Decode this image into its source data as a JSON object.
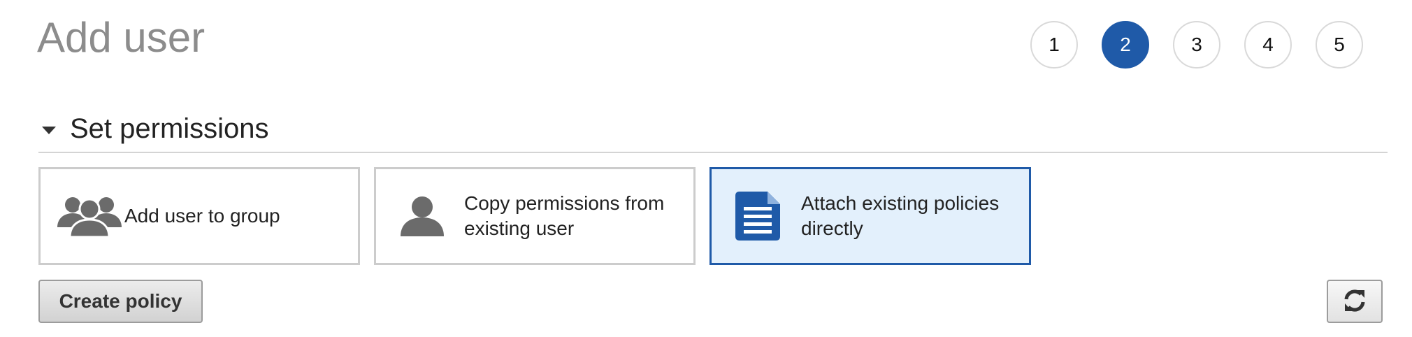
{
  "page": {
    "title": "Add user"
  },
  "steps": [
    {
      "label": "1",
      "active": false
    },
    {
      "label": "2",
      "active": true
    },
    {
      "label": "3",
      "active": false
    },
    {
      "label": "4",
      "active": false
    },
    {
      "label": "5",
      "active": false
    }
  ],
  "section": {
    "title": "Set permissions",
    "expanded": true
  },
  "options": [
    {
      "label": "Add user to group",
      "icon": "users-group-icon",
      "selected": false
    },
    {
      "label": "Copy permissions from existing user",
      "icon": "user-icon",
      "selected": false
    },
    {
      "label": "Attach existing policies directly",
      "icon": "document-icon",
      "selected": true
    }
  ],
  "actions": {
    "create_policy_label": "Create policy",
    "refresh_icon": "refresh-icon"
  },
  "colors": {
    "accent": "#1f5aa8",
    "selected_background": "#e3f0fc",
    "icon_gray": "#6b6b6b",
    "title_gray": "#8c8c8c"
  }
}
